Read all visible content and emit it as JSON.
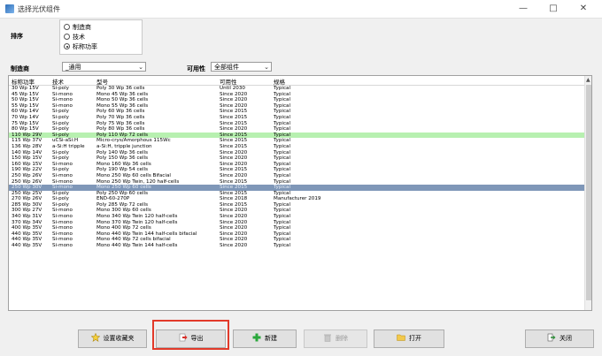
{
  "window": {
    "title": "选择光伏组件"
  },
  "sort": {
    "label": "排序",
    "options": [
      "制造商",
      "技术",
      "标称功率"
    ],
    "selected_index": 2
  },
  "filters": {
    "manufacturer_label": "制造商",
    "manufacturer_value": "_通用",
    "availability_label": "可用性",
    "availability_value": "全部组件"
  },
  "table": {
    "headers": [
      "标称功率",
      "技术",
      "型号",
      "可用性",
      "规格"
    ],
    "rows": [
      [
        "30 Wp 15V",
        "Si-poly",
        "Poly 30 Wp 36 cells",
        "Until 2030",
        "Typical"
      ],
      [
        "45 Wp 15V",
        "Si-mono",
        "Mono 45 Wp 36 cells",
        "Since 2020",
        "Typical"
      ],
      [
        "50 Wp 15V",
        "Si-mono",
        "Mono 50 Wp 36 cells",
        "Since 2020",
        "Typical"
      ],
      [
        "55 Wp 15V",
        "Si-mono",
        "Mono 55 Wp 36 cells",
        "Since 2020",
        "Typical"
      ],
      [
        "60 Wp 14V",
        "Si-poly",
        "Poly 60 Wp  36 cells",
        "Since 2015",
        "Typical"
      ],
      [
        "70 Wp 14V",
        "Si-poly",
        "Poly 70 Wp 36 cells",
        "Since 2015",
        "Typical"
      ],
      [
        "75 Wp 15V",
        "Si-poly",
        "Poly 75 Wp 36 cells",
        "Since 2015",
        "Typical"
      ],
      [
        "80 Wp 15V",
        "Si-poly",
        "Poly 80 Wp 36 cells",
        "Since 2020",
        "Typical"
      ],
      [
        "110 Wp 29V",
        "Si-poly",
        "Poly 110 Wp  72 cells",
        "Since 2015",
        "Typical"
      ],
      [
        "115 Wp 37V",
        "uCSi-aSi:H",
        "Micro-crys/Amorphous 115Wc",
        "Since 2015",
        "Typical"
      ],
      [
        "136 Wp 28V",
        "a-Si:H tripple",
        "a-Si:H, tripple junction",
        "Since 2015",
        "Typical"
      ],
      [
        "140 Wp 14V",
        "Si-poly",
        "Poly 140 Wp 36 cells",
        "Since 2020",
        "Typical"
      ],
      [
        "150 Wp 15V",
        "Si-poly",
        "Poly 150 Wp 36 cells",
        "Since 2020",
        "Typical"
      ],
      [
        "160 Wp 15V",
        "Si-mono",
        "Mono 160 Wp 36 cells",
        "Since 2020",
        "Typical"
      ],
      [
        "190 Wp 22V",
        "Si-poly",
        "Poly 190 Wp  54 cells",
        "Since 2015",
        "Typical"
      ],
      [
        "250 Wp 26V",
        "Si-mono",
        "Mono 250 Wp  60 cells Bifacial",
        "Since 2020",
        "Typical"
      ],
      [
        "250 Wp 26V",
        "Si-mono",
        "Mono 250 Wp  Twin, 120 half-cells",
        "Since 2015",
        "Typical"
      ],
      [
        "250 Wp 30V",
        "Si-mono",
        "Mono 250 Wp 60 cells",
        "Since 2015",
        "Typical"
      ],
      [
        "250 Wp 25V",
        "Si-poly",
        "Poly 250 Wp  60 cells",
        "Since 2015",
        "Typical"
      ],
      [
        "270 Wp 26V",
        "Si-poly",
        "END-60-270P",
        "Since 2018",
        "Manufacturer 2019"
      ],
      [
        "285 Wp 30V",
        "Si-poly",
        "Poly 285 Wp  72 cells",
        "Since 2015",
        "Typical"
      ],
      [
        "300 Wp 27V",
        "Si-mono",
        "Mono 300 Wp 60 cells",
        "Since 2020",
        "Typical"
      ],
      [
        "340 Wp 31V",
        "Si-mono",
        "Mono 340 Wp Twin 120 half-cells",
        "Since 2020",
        "Typical"
      ],
      [
        "370 Wp 34V",
        "Si-mono",
        "Mono 370 Wp Twin 120 half-cells",
        "Since 2020",
        "Typical"
      ],
      [
        "400 Wp 35V",
        "Si-mono",
        "Mono 400 Wp 72 cells",
        "Since 2020",
        "Typical"
      ],
      [
        "440 Wp 35V",
        "Si-mono",
        "Mono 440 Wp Twin 144 half-cells bifacial",
        "Since 2020",
        "Typical"
      ],
      [
        "440 Wp 35V",
        "Si-mono",
        "Mono 440 Wp 72 cells bifacial",
        "Since 2020",
        "Typical"
      ],
      [
        "440 Wp 35V",
        "Si-mono",
        "Mono 440 Wp Twin 144 half-cells",
        "Since 2020",
        "Typical"
      ]
    ],
    "highlighted_row_index": 8,
    "selected_row_index": 17,
    "highlight_color": "#b7f0b0",
    "selection_color": "#7f97b8"
  },
  "buttons": {
    "favorites": "设置收藏夹",
    "export": "导出",
    "new": "新建",
    "delete": "删除",
    "open": "打开",
    "close": "关闭"
  },
  "colors": {
    "accent_red": "#e23a2a",
    "export_outline": "#e23a2a"
  },
  "icons": {
    "favorites": "star-icon",
    "export": "export-arrow-icon",
    "new": "plus-icon",
    "delete": "trash-icon",
    "open": "folder-icon",
    "close": "exit-icon"
  }
}
